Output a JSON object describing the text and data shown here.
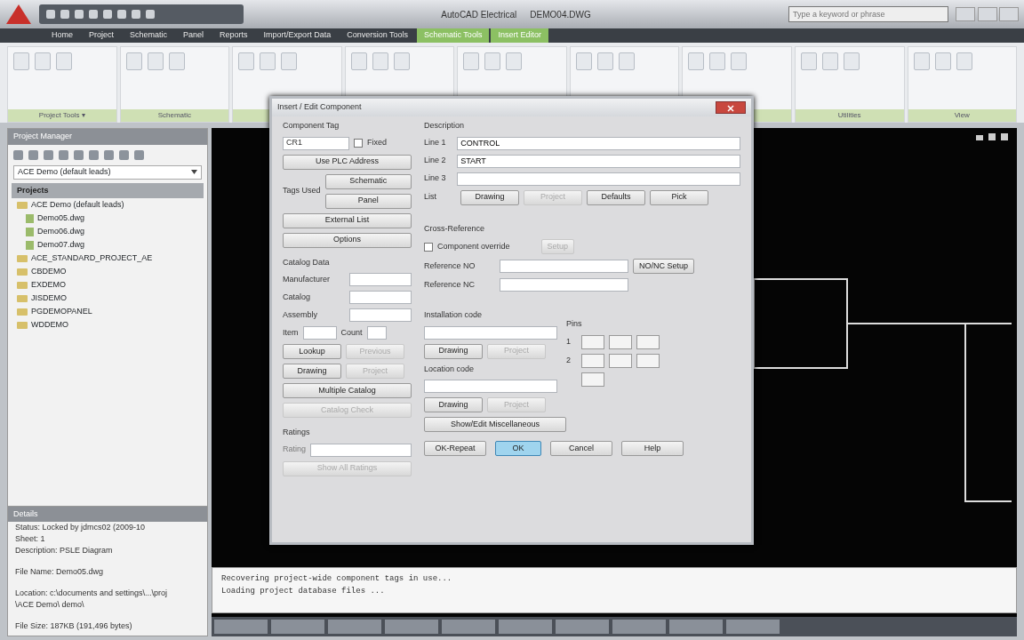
{
  "app": {
    "title": "AutoCAD Electrical",
    "file": "DEMO04.DWG",
    "search_placeholder": "Type a keyword or phrase"
  },
  "ribbon_tabs": [
    {
      "label": "Home",
      "kind": "normal"
    },
    {
      "label": "Project",
      "kind": "normal"
    },
    {
      "label": "Schematic",
      "kind": "normal"
    },
    {
      "label": "Panel",
      "kind": "normal"
    },
    {
      "label": "Reports",
      "kind": "normal"
    },
    {
      "label": "Import/Export Data",
      "kind": "normal"
    },
    {
      "label": "Conversion Tools",
      "kind": "normal"
    },
    {
      "label": "Schematic Tools",
      "kind": "contextual"
    },
    {
      "label": "Insert Editor",
      "kind": "contextual"
    }
  ],
  "ribbon_panels": [
    "Project Tools ▾",
    "Schematic",
    "Utilities",
    "View"
  ],
  "project_manager": {
    "title": "Project Manager",
    "project_select": "ACE Demo (default leads)",
    "section": "Projects",
    "tree": [
      {
        "label": "ACE Demo (default leads)",
        "kind": "project",
        "children": [
          {
            "label": "Demo05.dwg",
            "kind": "drawing"
          },
          {
            "label": "Demo06.dwg",
            "kind": "drawing"
          },
          {
            "label": "Demo07.dwg",
            "kind": "drawing"
          }
        ]
      },
      {
        "label": "ACE_STANDARD_PROJECT_AE",
        "kind": "project"
      },
      {
        "label": "CBDEMO",
        "kind": "project"
      },
      {
        "label": "EXDEMO",
        "kind": "project"
      },
      {
        "label": "JISDEMO",
        "kind": "project"
      },
      {
        "label": "PGDEMOPANEL",
        "kind": "project"
      },
      {
        "label": "WDDEMO",
        "kind": "project"
      }
    ]
  },
  "details": {
    "title": "Details",
    "paragraphs": [
      [
        "Status: Locked by jdmcs02 (2009-10",
        "Sheet: 1",
        "Description: PSLE Diagram"
      ],
      [
        "File Name: Demo05.dwg"
      ],
      [
        "Location: c:\\documents and settings\\...\\proj",
        "\\ACE Demo\\ demo\\"
      ],
      [
        "File Size: 187KB (191,496 bytes)"
      ]
    ]
  },
  "dialog": {
    "title": "Insert / Edit Component",
    "tag": {
      "title": "Component Tag",
      "label": "CR1",
      "fixed_label": "Fixed",
      "fixed": false,
      "use_plc": "Use PLC Address",
      "tags_used_label": "Tags Used",
      "schematic": "Schematic",
      "panel": "Panel",
      "external_list": "External List",
      "options": "Options"
    },
    "catalog": {
      "title": "Catalog Data",
      "fields": [
        {
          "label": "Manufacturer"
        },
        {
          "label": "Catalog"
        },
        {
          "label": "Assembly"
        }
      ],
      "item_label": "Item",
      "count_label": "Count",
      "buttons": [
        {
          "label": "Lookup",
          "disabled": false
        },
        {
          "label": "Previous",
          "disabled": true
        },
        {
          "label": "Drawing",
          "disabled": false
        },
        {
          "label": "Project",
          "disabled": true
        }
      ],
      "multiple": {
        "label": "Multiple Catalog",
        "disabled": false
      },
      "check": {
        "label": "Catalog Check",
        "disabled": true
      }
    },
    "ratings": {
      "title": "Ratings",
      "rating_label": "Rating",
      "show_all": "Show All Ratings",
      "disabled": true
    },
    "description": {
      "title": "Description",
      "lines": [
        {
          "label": "Line 1",
          "value": "CONTROL"
        },
        {
          "label": "Line 2",
          "value": "START"
        },
        {
          "label": "Line 3"
        }
      ],
      "list_label": "List",
      "buttons": [
        {
          "label": "Drawing",
          "disabled": false
        },
        {
          "label": "Project",
          "disabled": true
        },
        {
          "label": "Defaults",
          "disabled": false
        },
        {
          "label": "Pick",
          "disabled": false
        }
      ]
    },
    "cross_reference": {
      "title": "Cross-Reference",
      "override_label": "Component override",
      "override": false,
      "setup": "Setup",
      "setup_disabled": true,
      "no_label": "Reference NO",
      "nc_label": "Reference NC",
      "nonc_setup": "NO/NC Setup"
    },
    "installation": {
      "title": "Installation code",
      "drawing": "Drawing",
      "project": "Project",
      "project_disabled": true
    },
    "location": {
      "title": "Location code",
      "drawing": "Drawing",
      "project": "Project",
      "project_disabled": true
    },
    "pins": {
      "title": "Pins",
      "rows": [
        {
          "label": "1"
        },
        {
          "label": "2"
        }
      ]
    },
    "misc": "Show/Edit Miscellaneous",
    "footer": [
      {
        "label": "OK-Repeat",
        "default": false
      },
      {
        "label": "OK",
        "default": true
      },
      {
        "label": "Cancel",
        "default": false
      },
      {
        "label": "Help",
        "default": false
      }
    ]
  },
  "command_lines": [
    "Recovering project-wide component tags in use...",
    "Loading project database files ..."
  ]
}
